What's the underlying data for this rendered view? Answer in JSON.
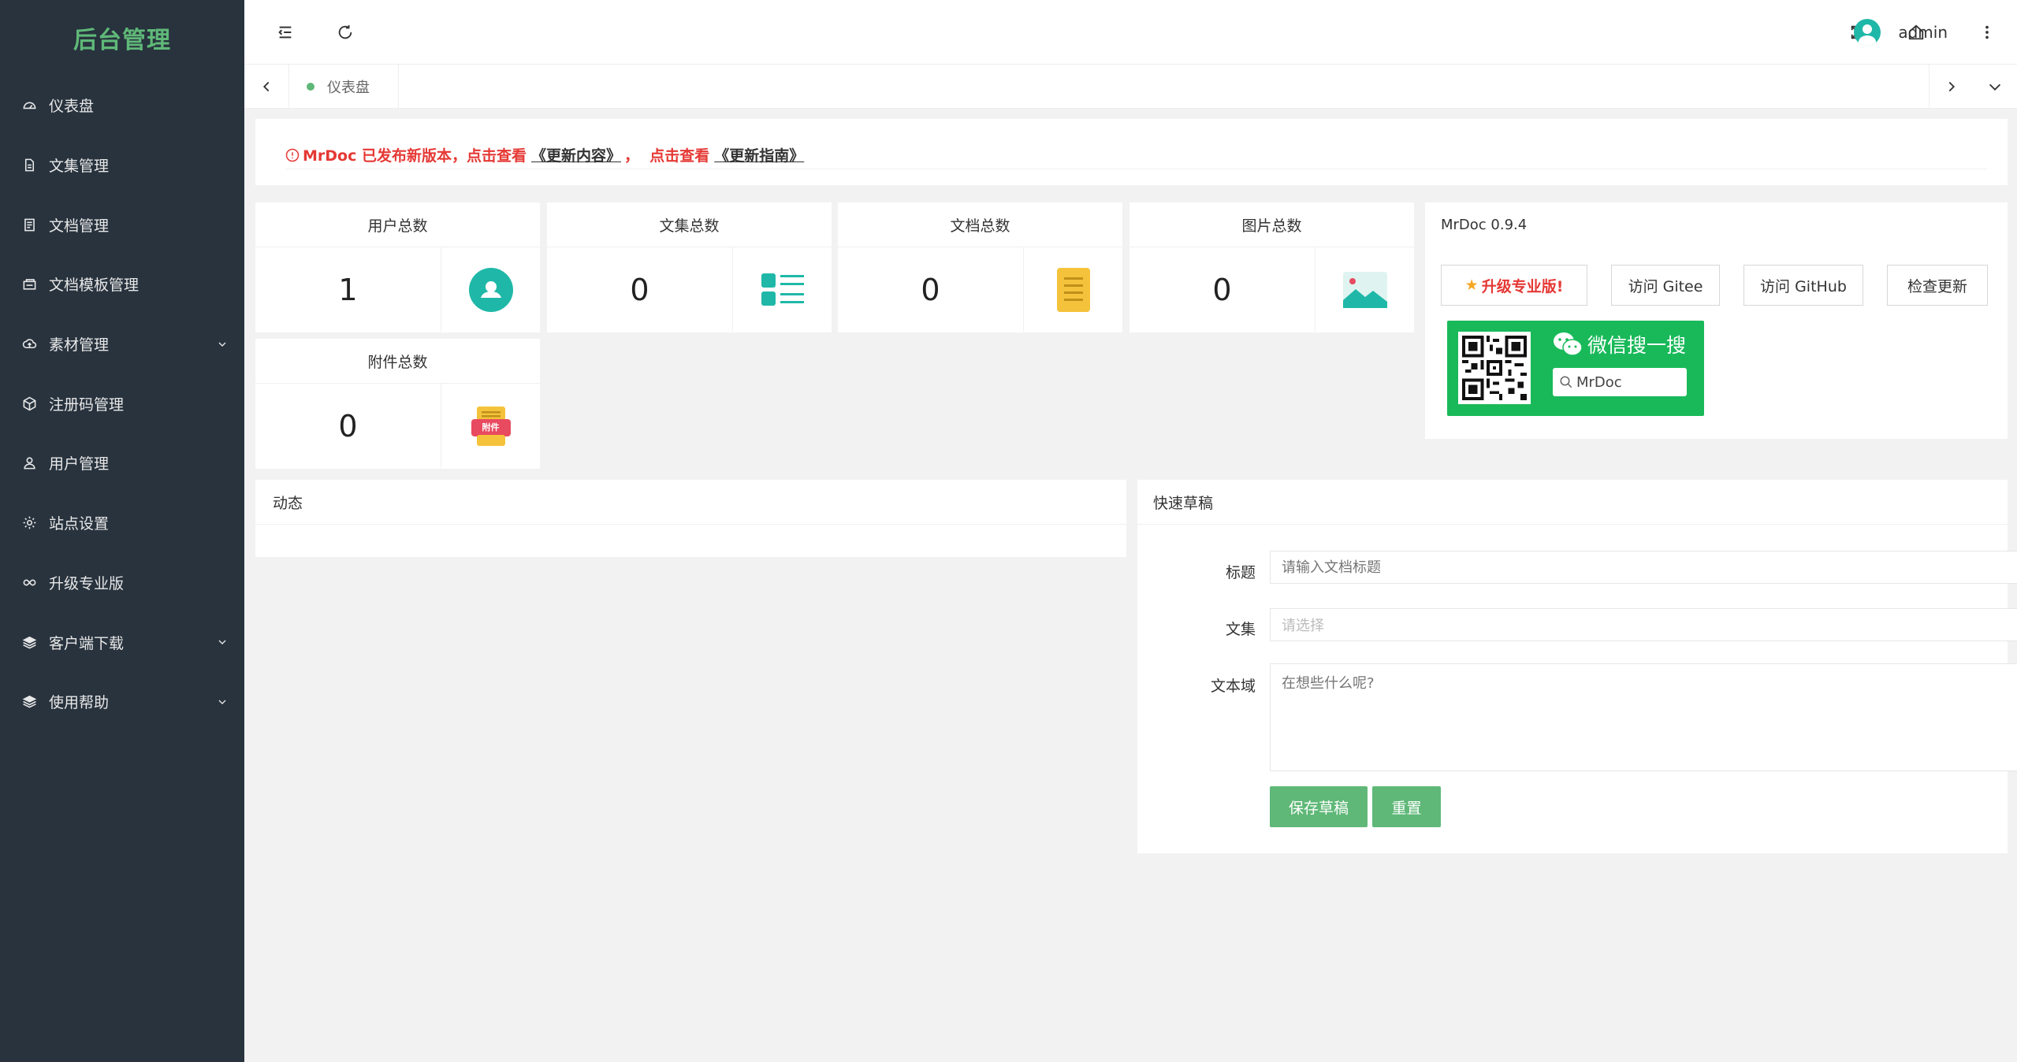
{
  "sidebar": {
    "logo": "后台管理",
    "items": [
      {
        "label": "仪表盘",
        "icon": "dashboard-icon"
      },
      {
        "label": "文集管理",
        "icon": "file-icon"
      },
      {
        "label": "文档管理",
        "icon": "document-icon"
      },
      {
        "label": "文档模板管理",
        "icon": "template-icon"
      },
      {
        "label": "素材管理",
        "icon": "cloud-icon",
        "expandable": true
      },
      {
        "label": "注册码管理",
        "icon": "box-icon"
      },
      {
        "label": "用户管理",
        "icon": "user-icon"
      },
      {
        "label": "站点设置",
        "icon": "gear-icon"
      },
      {
        "label": "升级专业版",
        "icon": "infinity-icon"
      },
      {
        "label": "客户端下载",
        "icon": "layers-icon",
        "expandable": true
      },
      {
        "label": "使用帮助",
        "icon": "layers-icon",
        "expandable": true
      }
    ]
  },
  "header": {
    "username": "admin"
  },
  "tabs": [
    {
      "label": "仪表盘",
      "active": true
    }
  ],
  "notice": {
    "text1": "MrDoc 已发布新版本，点击查看",
    "link1": "《更新内容》",
    "text2": "，  点击查看",
    "link2": "《更新指南》"
  },
  "stats": [
    {
      "title": "用户总数",
      "value": "1",
      "icon": "user-circle-icon"
    },
    {
      "title": "文集总数",
      "value": "0",
      "icon": "list-icon"
    },
    {
      "title": "文档总数",
      "value": "0",
      "icon": "document-icon"
    },
    {
      "title": "图片总数",
      "value": "0",
      "icon": "image-icon"
    },
    {
      "title": "附件总数",
      "value": "0",
      "icon": "attachment-icon",
      "badge": "附件"
    }
  ],
  "version_panel": {
    "title": "MrDoc 0.9.4",
    "buttons": {
      "upgrade": "升级专业版!",
      "gitee": "访问 Gitee",
      "github": "访问 GitHub",
      "check": "检查更新"
    },
    "wechat": {
      "title": "微信搜一搜",
      "search": "MrDoc"
    }
  },
  "activity": {
    "title": "动态"
  },
  "draft": {
    "title": "快速草稿",
    "fields": {
      "title_label": "标题",
      "title_placeholder": "请输入文档标题",
      "project_label": "文集",
      "project_placeholder": "请选择",
      "content_label": "文本域",
      "content_placeholder": "在想些什么呢?"
    },
    "save": "保存草稿",
    "reset": "重置"
  },
  "colors": {
    "sidebar_bg": "#28333e",
    "brand_green": "#5fb878",
    "teal": "#1fb8a8",
    "notice_red": "#e53935",
    "wechat_green": "#19b95a"
  }
}
